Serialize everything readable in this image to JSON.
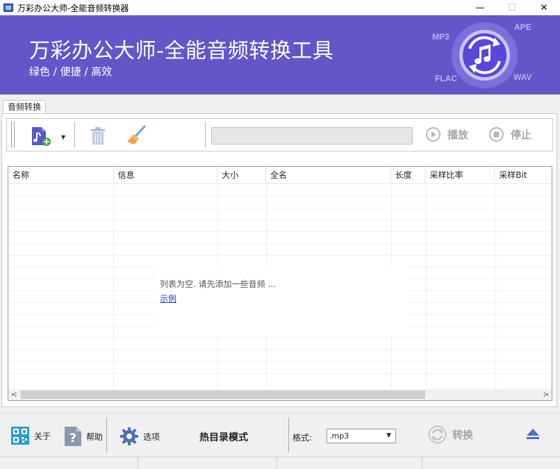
{
  "window": {
    "title": "万彩办公大师-全能音频转换器",
    "min_glyph": "—",
    "max_glyph": "☐",
    "close_glyph": "✕"
  },
  "banner": {
    "title": "万彩办公大师-全能音频转换工具",
    "subtitle": "绿色 / 便捷 / 高效",
    "formats": [
      "MP3",
      "APE",
      "FLAC",
      "WAV"
    ]
  },
  "tabs": [
    {
      "label": "音频转换",
      "active": true
    }
  ],
  "toolbar": {
    "add_icon": "add-audio-file-icon",
    "delete_icon": "trash-icon",
    "clear_icon": "broom-icon",
    "play_label": "播放",
    "stop_label": "停止"
  },
  "grid": {
    "columns": [
      "名称",
      "信息",
      "大小",
      "全名",
      "长度",
      "采样比率",
      "采样Bit"
    ],
    "empty_message": "列表为空. 请先添加一些音频 ...",
    "example_link": "示例"
  },
  "bottom": {
    "about_label": "关于",
    "help_label": "帮助",
    "options_label": "选项",
    "hot_dir_label": "热目录模式",
    "format_label": "格式:",
    "format_value": ".mp3",
    "convert_label": "转换"
  },
  "colors": {
    "banner": "#6456c9",
    "accent": "#4a3fd0",
    "link": "#1a3ec7"
  }
}
